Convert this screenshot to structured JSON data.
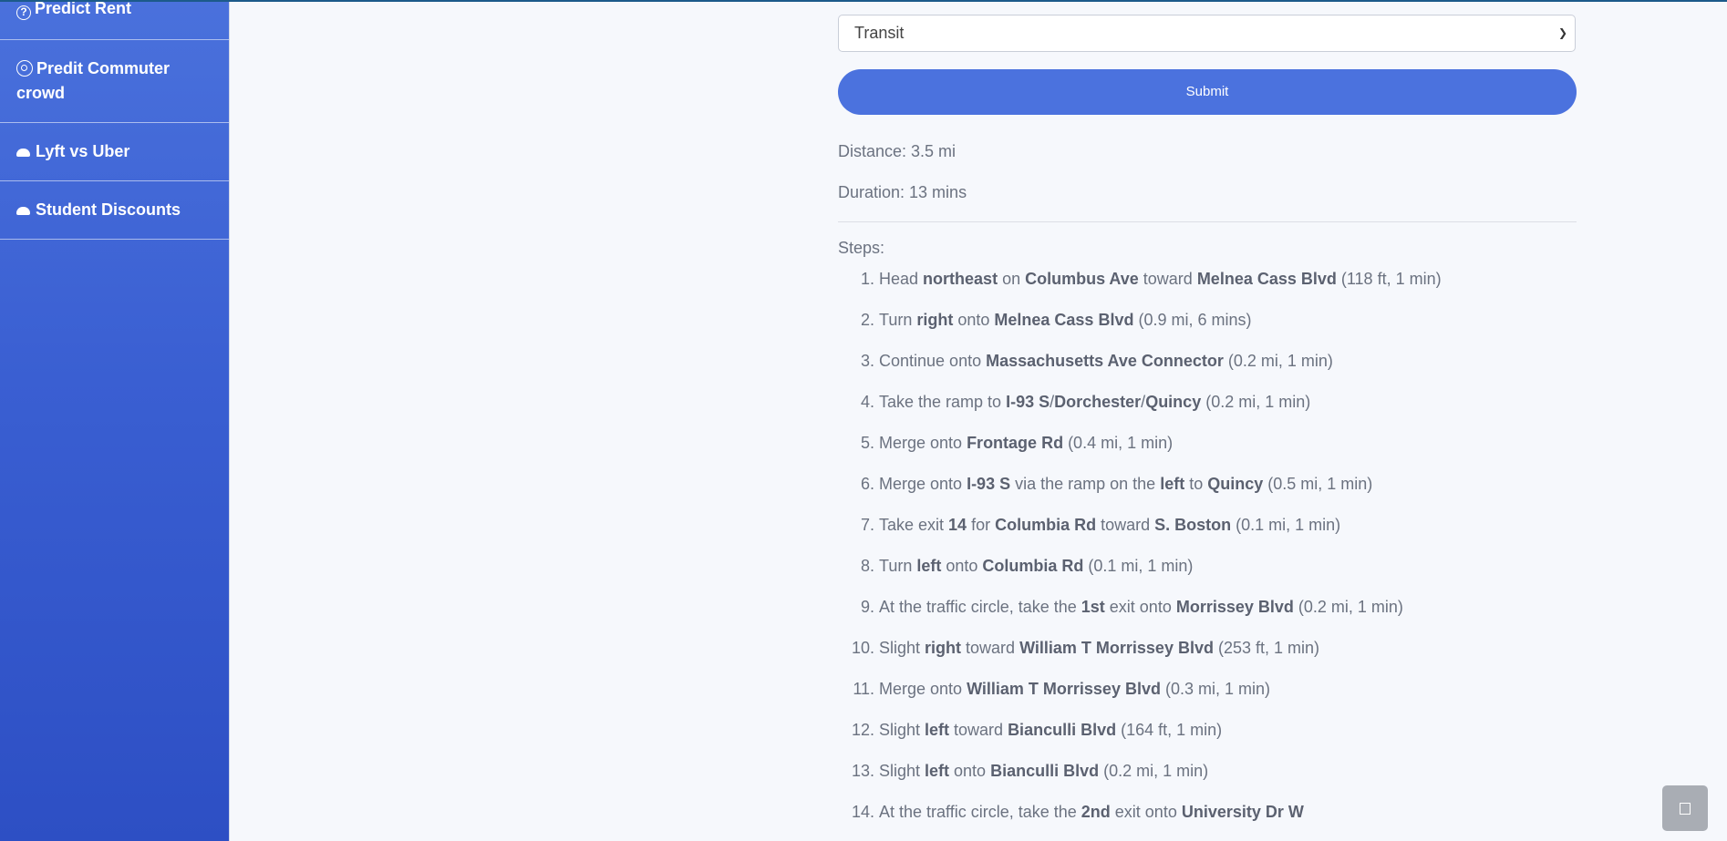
{
  "sidebar": {
    "items": [
      {
        "label": "Predict Rent",
        "icon": "question-circle-icon"
      },
      {
        "label": "Predit Commuter crowd",
        "icon": "target-icon"
      },
      {
        "label": "Lyft vs Uber",
        "icon": "car-icon"
      },
      {
        "label": "Student Discounts",
        "icon": "car-icon"
      }
    ]
  },
  "form": {
    "mode_selected": "Transit",
    "submit_label": "Submit"
  },
  "result": {
    "distance": "Distance: 3.5 mi",
    "duration": "Duration: 13 mins",
    "steps_label": "Steps:",
    "steps": [
      [
        [
          "Head "
        ],
        [
          "northeast",
          true
        ],
        [
          " on "
        ],
        [
          "Columbus Ave",
          true
        ],
        [
          " toward "
        ],
        [
          "Melnea Cass Blvd",
          true
        ],
        [
          " (118 ft, 1 min)"
        ]
      ],
      [
        [
          "Turn "
        ],
        [
          "right",
          true
        ],
        [
          " onto "
        ],
        [
          "Melnea Cass Blvd",
          true
        ],
        [
          " (0.9 mi, 6 mins)"
        ]
      ],
      [
        [
          "Continue onto "
        ],
        [
          "Massachusetts Ave Connector",
          true
        ],
        [
          " (0.2 mi, 1 min)"
        ]
      ],
      [
        [
          "Take the ramp to "
        ],
        [
          "I-93 S",
          true
        ],
        [
          "/"
        ],
        [
          "Dorchester",
          true
        ],
        [
          "/"
        ],
        [
          "Quincy",
          true
        ],
        [
          " (0.2 mi, 1 min)"
        ]
      ],
      [
        [
          "Merge onto "
        ],
        [
          "Frontage Rd",
          true
        ],
        [
          " (0.4 mi, 1 min)"
        ]
      ],
      [
        [
          "Merge onto "
        ],
        [
          "I-93 S",
          true
        ],
        [
          " via the ramp on the "
        ],
        [
          "left",
          true
        ],
        [
          " to "
        ],
        [
          "Quincy",
          true
        ],
        [
          " (0.5 mi, 1 min)"
        ]
      ],
      [
        [
          "Take exit "
        ],
        [
          "14",
          true
        ],
        [
          " for "
        ],
        [
          "Columbia Rd",
          true
        ],
        [
          " toward "
        ],
        [
          "S. Boston",
          true
        ],
        [
          " (0.1 mi, 1 min)"
        ]
      ],
      [
        [
          "Turn "
        ],
        [
          "left",
          true
        ],
        [
          " onto "
        ],
        [
          "Columbia Rd",
          true
        ],
        [
          " (0.1 mi, 1 min)"
        ]
      ],
      [
        [
          "At the traffic circle, take the "
        ],
        [
          "1st",
          true
        ],
        [
          " exit onto "
        ],
        [
          "Morrissey Blvd",
          true
        ],
        [
          " (0.2 mi, 1 min)"
        ]
      ],
      [
        [
          "Slight "
        ],
        [
          "right",
          true
        ],
        [
          " toward "
        ],
        [
          "William T Morrissey Blvd",
          true
        ],
        [
          " (253 ft, 1 min)"
        ]
      ],
      [
        [
          "Merge onto "
        ],
        [
          "William T Morrissey Blvd",
          true
        ],
        [
          " (0.3 mi, 1 min)"
        ]
      ],
      [
        [
          "Slight "
        ],
        [
          "left",
          true
        ],
        [
          " toward "
        ],
        [
          "Bianculli Blvd",
          true
        ],
        [
          " (164 ft, 1 min)"
        ]
      ],
      [
        [
          "Slight "
        ],
        [
          "left",
          true
        ],
        [
          " onto "
        ],
        [
          "Bianculli Blvd",
          true
        ],
        [
          " (0.2 mi, 1 min)"
        ]
      ],
      [
        [
          "At the traffic circle, take the "
        ],
        [
          "2nd",
          true
        ],
        [
          " exit onto "
        ],
        [
          "University Dr W",
          true
        ]
      ]
    ]
  },
  "colors": {
    "sidebar_top": "#4a71dc",
    "sidebar_bottom": "#2d4fc4",
    "accent": "#4b72de",
    "page_bg": "#f6f8fc"
  },
  "fab_icon": "square-icon"
}
